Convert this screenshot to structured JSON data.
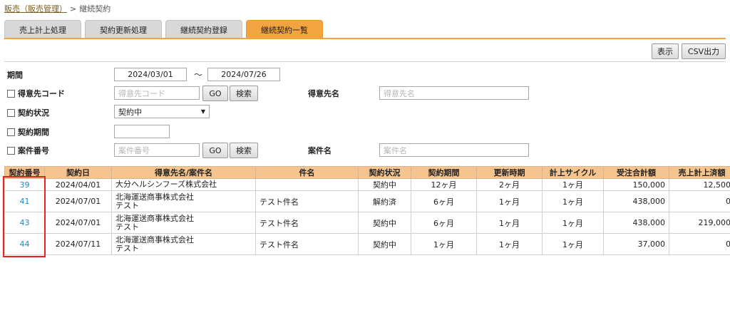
{
  "breadcrumb": {
    "parent": "販売（販売管理）",
    "separator": ">",
    "current": "継続契約"
  },
  "tabs": [
    {
      "label": "売上計上処理",
      "active": false
    },
    {
      "label": "契約更新処理",
      "active": false
    },
    {
      "label": "継続契約登録",
      "active": false
    },
    {
      "label": "継続契約一覧",
      "active": true
    }
  ],
  "toolbar": {
    "display_label": "表示",
    "csv_label": "CSV出力"
  },
  "form": {
    "period": {
      "label": "期間",
      "from": "2024/03/01",
      "tilde": "～",
      "to": "2024/07/26"
    },
    "customer_code": {
      "label": "得意先コード",
      "placeholder": "得意先コード",
      "go_label": "GO",
      "search_label": "検索"
    },
    "customer_name": {
      "label": "得意先名",
      "placeholder": "得意先名"
    },
    "status": {
      "label": "契約状況",
      "value": "契約中",
      "caret": "▼"
    },
    "contract_period": {
      "label": "契約期間",
      "value": ""
    },
    "project_no": {
      "label": "案件番号",
      "placeholder": "案件番号",
      "go_label": "GO",
      "search_label": "検索"
    },
    "project_name": {
      "label": "案件名",
      "placeholder": "案件名"
    }
  },
  "table": {
    "headers": [
      "契約番号",
      "契約日",
      "得意先名/案件名",
      "件名",
      "契約状況",
      "契約期間",
      "更新時期",
      "計上サイクル",
      "受注合計額",
      "売上計上済額"
    ],
    "rows": [
      {
        "no": "39",
        "date": "2024/04/01",
        "customer": "大分ヘルシンフーズ株式会社",
        "project": "",
        "subject": "",
        "status": "契約中",
        "period": "12ヶ月",
        "renewal": "2ヶ月",
        "cycle": "1ヶ月",
        "total": "150,000",
        "booked": "12,500"
      },
      {
        "no": "41",
        "date": "2024/07/01",
        "customer": "北海運送商事株式会社",
        "project": "テスト",
        "subject": "テスト件名",
        "status": "解約済",
        "period": "6ヶ月",
        "renewal": "1ヶ月",
        "cycle": "1ヶ月",
        "total": "438,000",
        "booked": "0"
      },
      {
        "no": "43",
        "date": "2024/07/01",
        "customer": "北海運送商事株式会社",
        "project": "テスト",
        "subject": "テスト件名",
        "status": "契約中",
        "period": "6ヶ月",
        "renewal": "1ヶ月",
        "cycle": "1ヶ月",
        "total": "438,000",
        "booked": "219,000"
      },
      {
        "no": "44",
        "date": "2024/07/11",
        "customer": "北海運送商事株式会社",
        "project": "テスト",
        "subject": "テスト件名",
        "status": "契約中",
        "period": "1ヶ月",
        "renewal": "1ヶ月",
        "cycle": "1ヶ月",
        "total": "37,000",
        "booked": "0"
      }
    ]
  },
  "colors": {
    "accent": "#f3a33f",
    "header_bg": "#f6c48e",
    "link": "#1a8ac6",
    "highlight": "#e8231f"
  }
}
